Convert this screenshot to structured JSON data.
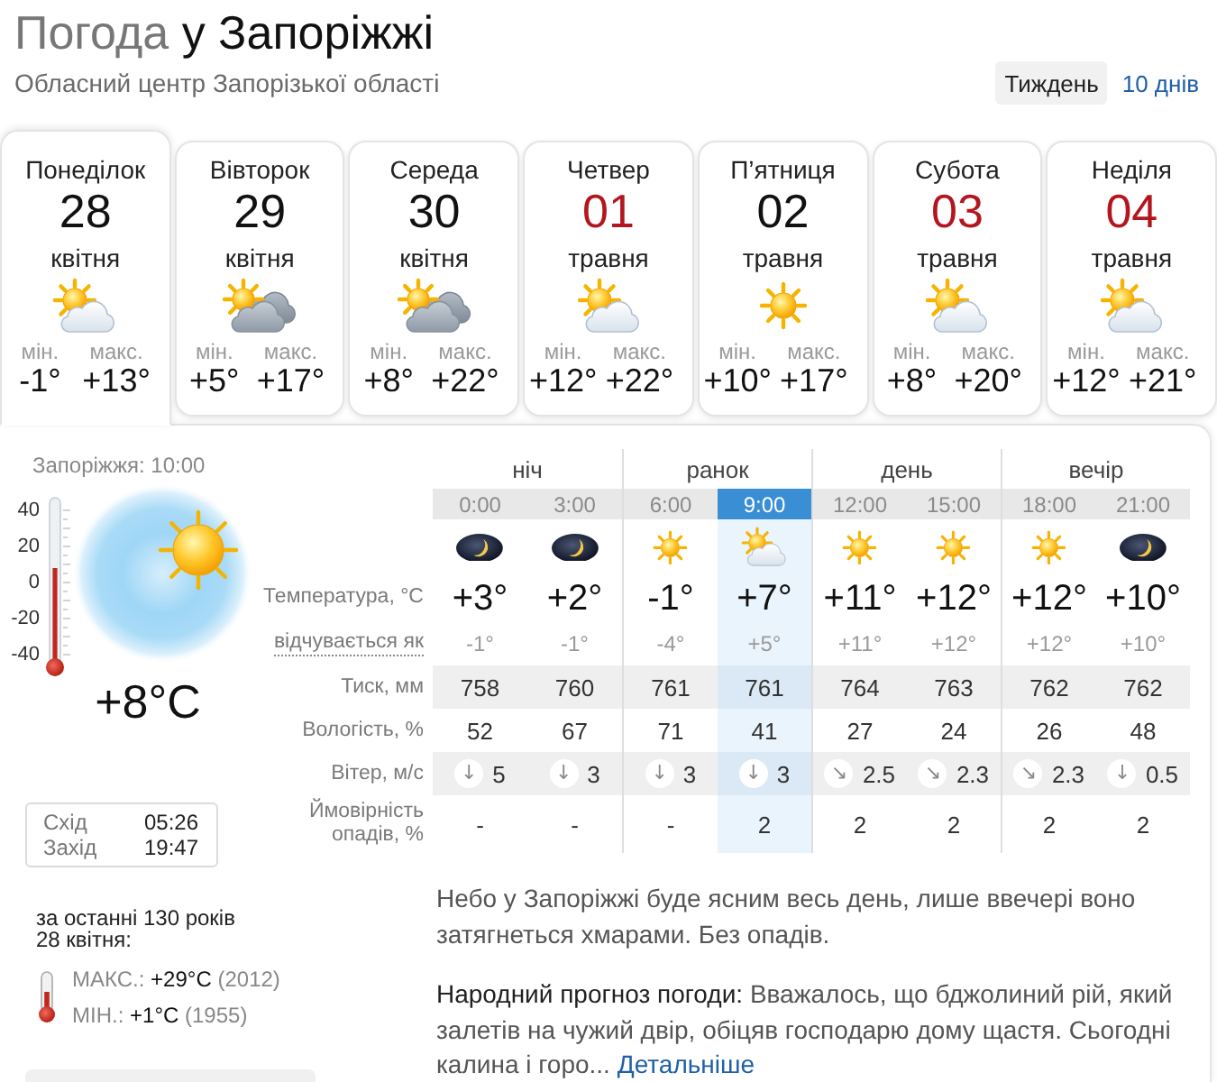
{
  "header": {
    "title_prefix": "Погода",
    "title_city": "у Запоріжжі",
    "subtitle": "Обласний центр Запорізької області",
    "range_tabs": [
      {
        "label": "Тиждень",
        "selected": true
      },
      {
        "label": "10 днів",
        "selected": false
      }
    ]
  },
  "days": [
    {
      "weekday": "Понеділок",
      "date": "28",
      "month": "квітня",
      "day_off": false,
      "kind": "partly-cloudy",
      "min_label": "мін.",
      "min": "-1°",
      "max_label": "макс.",
      "max": "+13°",
      "selected": true
    },
    {
      "weekday": "Вівторок",
      "date": "29",
      "month": "квітня",
      "day_off": false,
      "kind": "cloudy",
      "min_label": "мін.",
      "min": "+5°",
      "max_label": "макс.",
      "max": "+17°",
      "selected": false
    },
    {
      "weekday": "Середа",
      "date": "30",
      "month": "квітня",
      "day_off": false,
      "kind": "cloudy",
      "min_label": "мін.",
      "min": "+8°",
      "max_label": "макс.",
      "max": "+22°",
      "selected": false
    },
    {
      "weekday": "Четвер",
      "date": "01",
      "month": "травня",
      "day_off": true,
      "kind": "partly-cloudy",
      "min_label": "мін.",
      "min": "+12°",
      "max_label": "макс.",
      "max": "+22°",
      "selected": false
    },
    {
      "weekday": "П’ятниця",
      "date": "02",
      "month": "травня",
      "day_off": false,
      "kind": "clear",
      "min_label": "мін.",
      "min": "+10°",
      "max_label": "макс.",
      "max": "+17°",
      "selected": false
    },
    {
      "weekday": "Субота",
      "date": "03",
      "month": "травня",
      "day_off": true,
      "kind": "partly-cloudy",
      "min_label": "мін.",
      "min": "+8°",
      "max_label": "макс.",
      "max": "+20°",
      "selected": false
    },
    {
      "weekday": "Неділя",
      "date": "04",
      "month": "травня",
      "day_off": true,
      "kind": "partly-cloudy",
      "min_label": "мін.",
      "min": "+12°",
      "max_label": "макс.",
      "max": "+21°",
      "selected": false
    }
  ],
  "current": {
    "place_time": "Запоріжжя: 10:00",
    "scale": [
      "40",
      "20",
      "0",
      "-20",
      "-40"
    ],
    "thermometer": {
      "level": 0.6
    },
    "temperature": "+8°C",
    "sun": [
      {
        "label": "Схід",
        "time": "05:26"
      },
      {
        "label": "Захід",
        "time": "19:47"
      }
    ]
  },
  "hourly": {
    "row_labels": [
      {
        "text": "Температура, °C",
        "has_tooltip": false
      },
      {
        "text": "відчувається як",
        "has_tooltip": true
      },
      {
        "text": "Тиск, мм",
        "has_tooltip": false
      },
      {
        "text": "Вологість, %",
        "has_tooltip": false
      },
      {
        "text": "Вітер, м/с",
        "has_tooltip": false
      },
      {
        "text": "Ймовірність опадів, %",
        "has_tooltip": false
      }
    ],
    "periods": [
      {
        "name": "ніч",
        "hours": [
          {
            "time": "0:00",
            "kind": "night",
            "temp": "+3°",
            "feels": "-1°",
            "pressure": "758",
            "humidity": "52",
            "wind_arrow": "↓",
            "wind": "5",
            "precip": "-",
            "current": false
          },
          {
            "time": "3:00",
            "kind": "night",
            "temp": "+2°",
            "feels": "-1°",
            "pressure": "760",
            "humidity": "67",
            "wind_arrow": "↓",
            "wind": "3",
            "precip": "-",
            "current": false
          }
        ]
      },
      {
        "name": "ранок",
        "hours": [
          {
            "time": "6:00",
            "kind": "clear",
            "temp": "-1°",
            "feels": "-4°",
            "pressure": "761",
            "humidity": "71",
            "wind_arrow": "↓",
            "wind": "3",
            "precip": "-",
            "current": false
          },
          {
            "time": "9:00",
            "kind": "partly-cloudy",
            "temp": "+7°",
            "feels": "+5°",
            "pressure": "761",
            "humidity": "41",
            "wind_arrow": "↓",
            "wind": "3",
            "precip": "2",
            "current": true
          }
        ]
      },
      {
        "name": "день",
        "hours": [
          {
            "time": "12:00",
            "kind": "clear",
            "temp": "+11°",
            "feels": "+11°",
            "pressure": "764",
            "humidity": "27",
            "wind_arrow": "↘",
            "wind": "2.5",
            "precip": "2",
            "current": false
          },
          {
            "time": "15:00",
            "kind": "clear",
            "temp": "+12°",
            "feels": "+12°",
            "pressure": "763",
            "humidity": "24",
            "wind_arrow": "↘",
            "wind": "2.3",
            "precip": "2",
            "current": false
          }
        ]
      },
      {
        "name": "вечір",
        "hours": [
          {
            "time": "18:00",
            "kind": "clear",
            "temp": "+12°",
            "feels": "+12°",
            "pressure": "762",
            "humidity": "26",
            "wind_arrow": "↘",
            "wind": "2.3",
            "precip": "2",
            "current": false
          },
          {
            "time": "21:00",
            "kind": "night",
            "temp": "+10°",
            "feels": "+10°",
            "pressure": "762",
            "humidity": "48",
            "wind_arrow": "↓",
            "wind": "0.5",
            "precip": "2",
            "current": false
          }
        ]
      }
    ]
  },
  "records": {
    "title": "за останні 130 років",
    "date": "28 квітня:",
    "items": [
      {
        "label": "МАКС.:",
        "value": "+29°C",
        "year": "(2012)"
      },
      {
        "label": "МІН.:",
        "value": "+1°C",
        "year": "(1955)"
      }
    ]
  },
  "description": "Небо у Запоріжжі буде ясним весь день, лише ввечері воно затягнеться хмарами. Без опадів.",
  "folk_forecast": {
    "label": "Народний прогноз погоди:",
    "text": "Вважалось, що бджолиний рій, який залетів на чужий двір, обіцяв господарю дому щастя. Сьогодні калина і горо...",
    "link": "Детальніше"
  }
}
